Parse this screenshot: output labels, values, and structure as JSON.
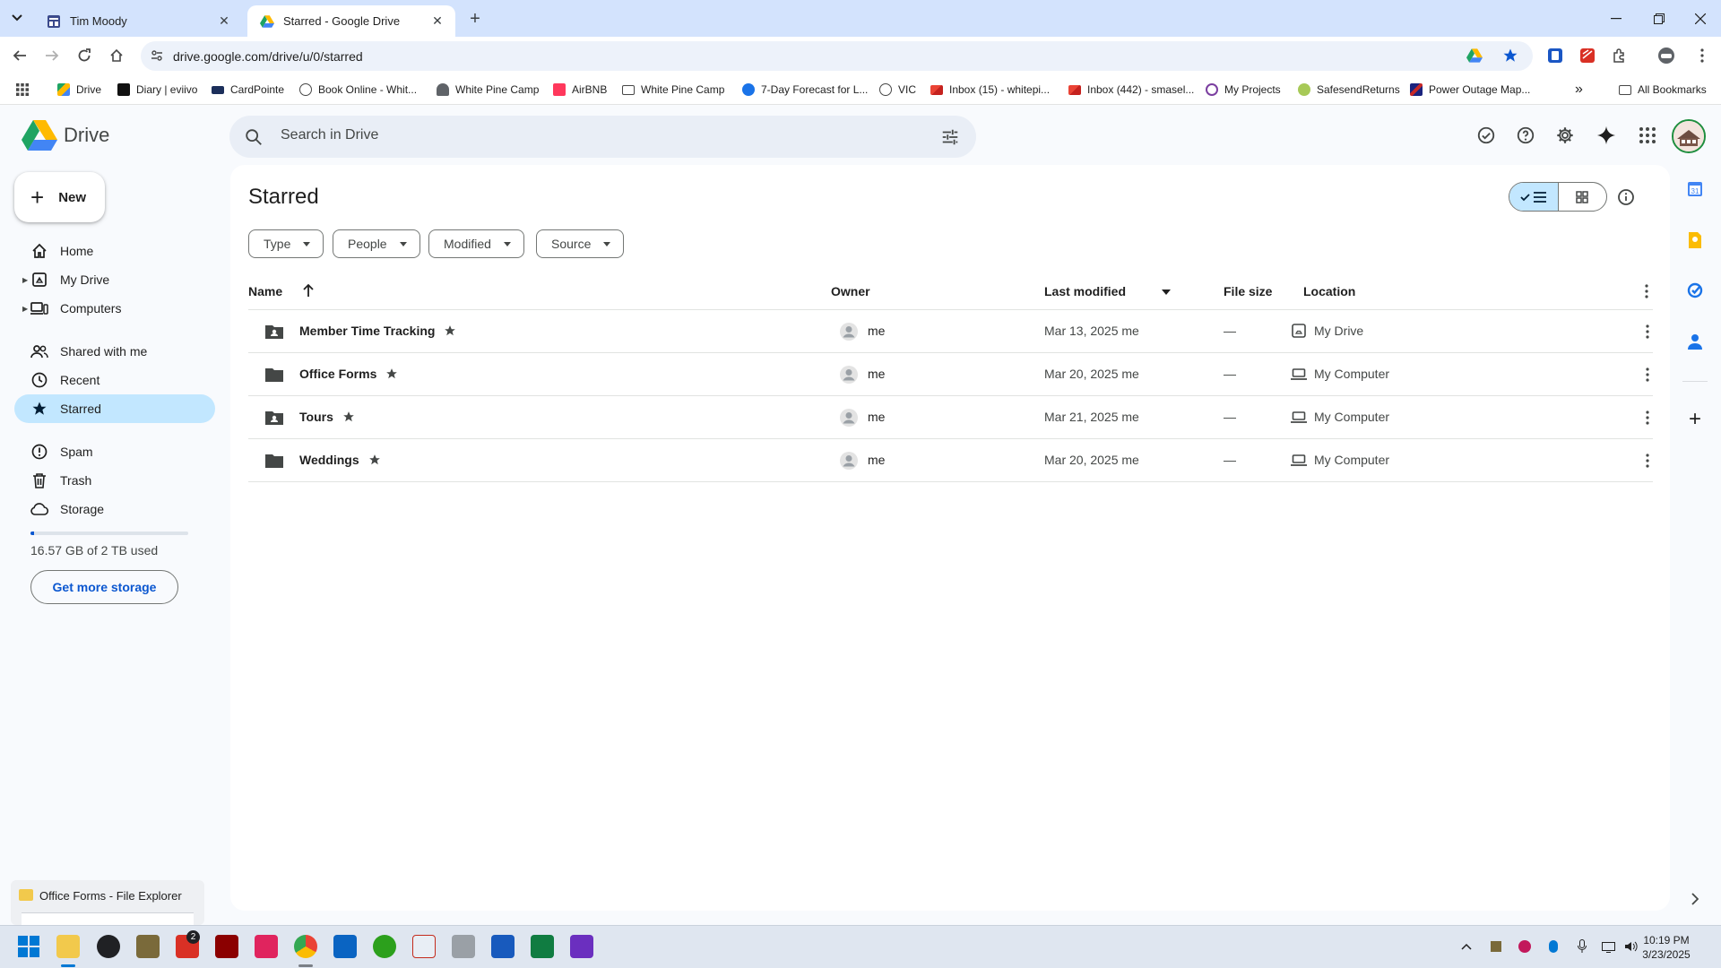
{
  "browser": {
    "tabs": [
      {
        "title": "Tim Moody",
        "active": false
      },
      {
        "title": "Starred - Google Drive",
        "active": true
      }
    ],
    "url": "drive.google.com/drive/u/0/starred",
    "bookmarks": [
      {
        "label": "Drive",
        "icon": "drive-icon"
      },
      {
        "label": "Diary | eviivo",
        "icon": "eviivo-icon"
      },
      {
        "label": "CardPointe",
        "icon": "card-icon"
      },
      {
        "label": "Book Online - Whit...",
        "icon": "globe-icon"
      },
      {
        "label": "White Pine Camp",
        "icon": "camp-icon"
      },
      {
        "label": "AirBNB",
        "icon": "airbnb-icon"
      },
      {
        "label": "White Pine Camp",
        "icon": "folder-icon"
      },
      {
        "label": "7-Day Forecast for L...",
        "icon": "weather-icon"
      },
      {
        "label": "VIC",
        "icon": "globe-icon"
      },
      {
        "label": "Inbox (15) - whitepi...",
        "icon": "gmail-icon"
      },
      {
        "label": "Inbox (442) - smasel...",
        "icon": "gmail-icon"
      },
      {
        "label": "My Projects",
        "icon": "projects-icon"
      },
      {
        "label": "SafesendReturns",
        "icon": "safesend-icon"
      },
      {
        "label": "Power Outage Map...",
        "icon": "map-icon"
      }
    ],
    "all_bookmarks": "All Bookmarks"
  },
  "drive": {
    "logo_text": "Drive",
    "search_placeholder": "Search in Drive",
    "new_label": "New",
    "nav": [
      {
        "label": "Home",
        "icon": "home-icon"
      },
      {
        "label": "My Drive",
        "icon": "my-drive-icon"
      },
      {
        "label": "Computers",
        "icon": "computers-icon"
      },
      {
        "label": "Shared with me",
        "icon": "shared-icon"
      },
      {
        "label": "Recent",
        "icon": "clock-icon"
      },
      {
        "label": "Starred",
        "icon": "star-icon"
      },
      {
        "label": "Spam",
        "icon": "spam-icon"
      },
      {
        "label": "Trash",
        "icon": "trash-icon"
      },
      {
        "label": "Storage",
        "icon": "cloud-icon"
      }
    ],
    "storage": {
      "text": "16.57 GB of 2 TB used",
      "used_fraction": 0.008,
      "cta": "Get more storage"
    },
    "page_title": "Starred",
    "filters": [
      "Type",
      "People",
      "Modified",
      "Source"
    ],
    "columns": {
      "name": "Name",
      "owner": "Owner",
      "modified": "Last modified",
      "size": "File size",
      "location": "Location"
    },
    "files": [
      {
        "name": "Member Time Tracking",
        "type": "shared-folder",
        "owner": "me",
        "modified": "Mar 13, 2025 me",
        "size": "—",
        "location": "My Drive",
        "location_icon": "my-drive-icon"
      },
      {
        "name": "Office Forms",
        "type": "folder",
        "owner": "me",
        "modified": "Mar 20, 2025 me",
        "size": "—",
        "location": "My Computer",
        "location_icon": "laptop-icon"
      },
      {
        "name": "Tours",
        "type": "shared-folder",
        "owner": "me",
        "modified": "Mar 21, 2025 me",
        "size": "—",
        "location": "My Computer",
        "location_icon": "laptop-icon"
      },
      {
        "name": "Weddings",
        "type": "folder",
        "owner": "me",
        "modified": "Mar 20, 2025 me",
        "size": "—",
        "location": "My Computer",
        "location_icon": "laptop-icon"
      }
    ]
  },
  "os": {
    "preview_title": "Office Forms - File Explorer",
    "chrome_badge": "2",
    "time": "10:19 PM",
    "date": "3/23/2025"
  },
  "colors": {
    "accent": "#0b57d0",
    "active_nav": "#c2e7ff",
    "tab_strip": "#d3e3fd"
  }
}
